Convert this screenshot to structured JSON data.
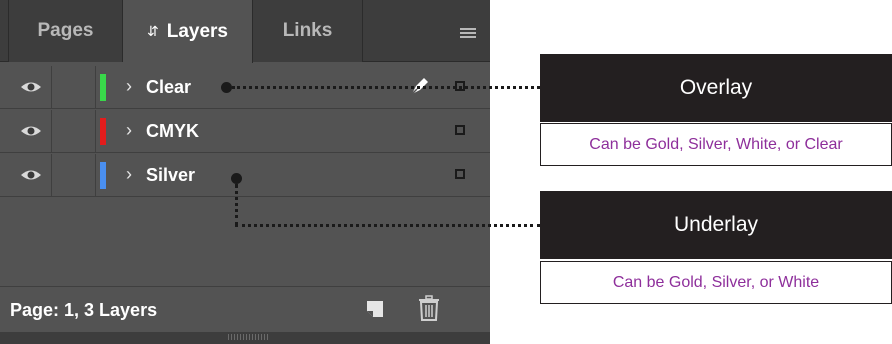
{
  "tabs": [
    {
      "label": "Pages"
    },
    {
      "label": "Layers",
      "icon": "sort-arrows-icon"
    },
    {
      "label": "Links"
    }
  ],
  "layers": [
    {
      "name": "Clear",
      "color": "#39d84a"
    },
    {
      "name": "CMYK",
      "color": "#e31c1c"
    },
    {
      "name": "Silver",
      "color": "#4a8ff0"
    }
  ],
  "footer": {
    "status": "Page: 1, 3 Layers"
  },
  "callouts": {
    "overlay": {
      "title": "Overlay",
      "desc": "Can be Gold, Silver, White, or Clear"
    },
    "underlay": {
      "title": "Underlay",
      "desc": "Can be Gold, Silver, or White"
    }
  },
  "colors": {
    "panel_bg": "#535353",
    "tabbar_bg": "#3d3d3d",
    "callout_header_bg": "#231f20",
    "callout_text": "#8e2f9b"
  }
}
